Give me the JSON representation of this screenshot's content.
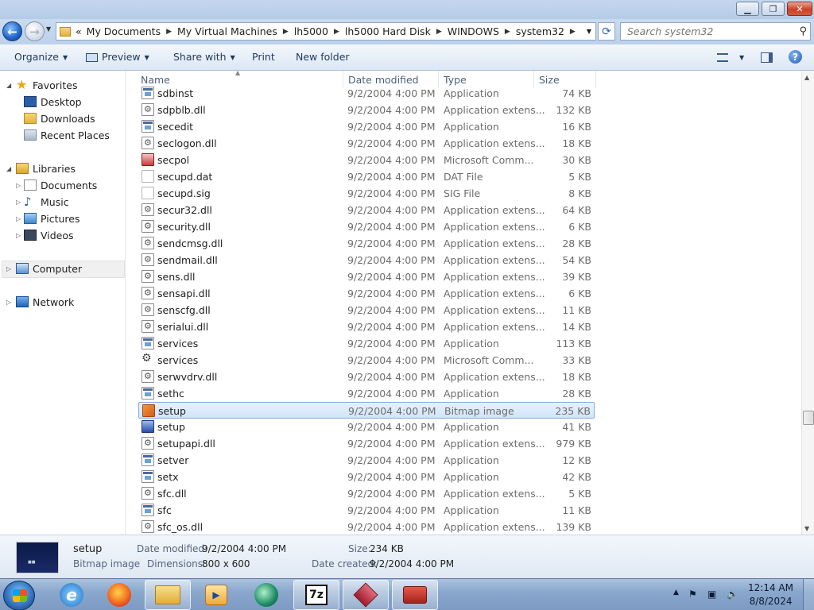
{
  "window": {
    "minimize_icon": "minimize-icon",
    "maximize_icon": "restore-icon",
    "close_icon": "close-icon",
    "minimize_glyph": "▁",
    "restore_glyph": "❐",
    "close_glyph": "✕"
  },
  "address": {
    "overflow": "«",
    "breadcrumb": [
      "My Documents",
      "My Virtual Machines",
      "lh5000",
      "lh5000 Hard Disk",
      "WINDOWS",
      "system32"
    ],
    "search_placeholder": "Search system32"
  },
  "toolbar": {
    "organize": "Organize",
    "preview": "Preview",
    "share_with": "Share with",
    "print": "Print",
    "new_folder": "New folder"
  },
  "nav": {
    "favorites": "Favorites",
    "desktop": "Desktop",
    "downloads": "Downloads",
    "recent_places": "Recent Places",
    "libraries": "Libraries",
    "documents": "Documents",
    "music": "Music",
    "pictures": "Pictures",
    "videos": "Videos",
    "computer": "Computer",
    "network": "Network"
  },
  "columns": {
    "name": "Name",
    "date": "Date modified",
    "type": "Type",
    "size": "Size"
  },
  "files": [
    {
      "name": "sdbinst",
      "date": "9/2/2004 4:00 PM",
      "type": "Application",
      "size": "74 KB",
      "icon": "app"
    },
    {
      "name": "sdpblb.dll",
      "date": "9/2/2004 4:00 PM",
      "type": "Application extens...",
      "size": "132 KB",
      "icon": "dll"
    },
    {
      "name": "secedit",
      "date": "9/2/2004 4:00 PM",
      "type": "Application",
      "size": "16 KB",
      "icon": "app"
    },
    {
      "name": "seclogon.dll",
      "date": "9/2/2004 4:00 PM",
      "type": "Application extens...",
      "size": "18 KB",
      "icon": "dll"
    },
    {
      "name": "secpol",
      "date": "9/2/2004 4:00 PM",
      "type": "Microsoft Comm...",
      "size": "30 KB",
      "icon": "msc"
    },
    {
      "name": "secupd.dat",
      "date": "9/2/2004 4:00 PM",
      "type": "DAT File",
      "size": "5 KB",
      "icon": "doc"
    },
    {
      "name": "secupd.sig",
      "date": "9/2/2004 4:00 PM",
      "type": "SIG File",
      "size": "8 KB",
      "icon": "doc"
    },
    {
      "name": "secur32.dll",
      "date": "9/2/2004 4:00 PM",
      "type": "Application extens...",
      "size": "64 KB",
      "icon": "dll"
    },
    {
      "name": "security.dll",
      "date": "9/2/2004 4:00 PM",
      "type": "Application extens...",
      "size": "6 KB",
      "icon": "dll"
    },
    {
      "name": "sendcmsg.dll",
      "date": "9/2/2004 4:00 PM",
      "type": "Application extens...",
      "size": "28 KB",
      "icon": "dll"
    },
    {
      "name": "sendmail.dll",
      "date": "9/2/2004 4:00 PM",
      "type": "Application extens...",
      "size": "54 KB",
      "icon": "dll"
    },
    {
      "name": "sens.dll",
      "date": "9/2/2004 4:00 PM",
      "type": "Application extens...",
      "size": "39 KB",
      "icon": "dll"
    },
    {
      "name": "sensapi.dll",
      "date": "9/2/2004 4:00 PM",
      "type": "Application extens...",
      "size": "6 KB",
      "icon": "dll"
    },
    {
      "name": "senscfg.dll",
      "date": "9/2/2004 4:00 PM",
      "type": "Application extens...",
      "size": "11 KB",
      "icon": "dll"
    },
    {
      "name": "serialui.dll",
      "date": "9/2/2004 4:00 PM",
      "type": "Application extens...",
      "size": "14 KB",
      "icon": "dll"
    },
    {
      "name": "services",
      "date": "9/2/2004 4:00 PM",
      "type": "Application",
      "size": "113 KB",
      "icon": "app"
    },
    {
      "name": "services",
      "date": "9/2/2004 4:00 PM",
      "type": "Microsoft Comm...",
      "size": "33 KB",
      "icon": "gear"
    },
    {
      "name": "serwvdrv.dll",
      "date": "9/2/2004 4:00 PM",
      "type": "Application extens...",
      "size": "18 KB",
      "icon": "dll"
    },
    {
      "name": "sethc",
      "date": "9/2/2004 4:00 PM",
      "type": "Application",
      "size": "28 KB",
      "icon": "app"
    },
    {
      "name": "setup",
      "date": "9/2/2004 4:00 PM",
      "type": "Bitmap image",
      "size": "235 KB",
      "icon": "bmp",
      "selected": true
    },
    {
      "name": "setup",
      "date": "9/2/2004 4:00 PM",
      "type": "Application",
      "size": "41 KB",
      "icon": "setup"
    },
    {
      "name": "setupapi.dll",
      "date": "9/2/2004 4:00 PM",
      "type": "Application extens...",
      "size": "979 KB",
      "icon": "dll"
    },
    {
      "name": "setver",
      "date": "9/2/2004 4:00 PM",
      "type": "Application",
      "size": "12 KB",
      "icon": "app"
    },
    {
      "name": "setx",
      "date": "9/2/2004 4:00 PM",
      "type": "Application",
      "size": "42 KB",
      "icon": "app"
    },
    {
      "name": "sfc.dll",
      "date": "9/2/2004 4:00 PM",
      "type": "Application extens...",
      "size": "5 KB",
      "icon": "dll"
    },
    {
      "name": "sfc",
      "date": "9/2/2004 4:00 PM",
      "type": "Application",
      "size": "11 KB",
      "icon": "app"
    },
    {
      "name": "sfc_os.dll",
      "date": "9/2/2004 4:00 PM",
      "type": "Application extens...",
      "size": "139 KB",
      "icon": "dll"
    }
  ],
  "details": {
    "name": "setup",
    "type": "Bitmap image",
    "date_modified_label": "Date modified:",
    "date_modified": "9/2/2004 4:00 PM",
    "dimensions_label": "Dimensions:",
    "dimensions": "800 x 600",
    "size_label": "Size:",
    "size": "234 KB",
    "date_created_label": "Date created:",
    "date_created": "9/2/2004 4:00 PM"
  },
  "taskbar": {
    "time": "12:14 AM",
    "date": "8/8/2024",
    "seven_zip": "7z"
  }
}
